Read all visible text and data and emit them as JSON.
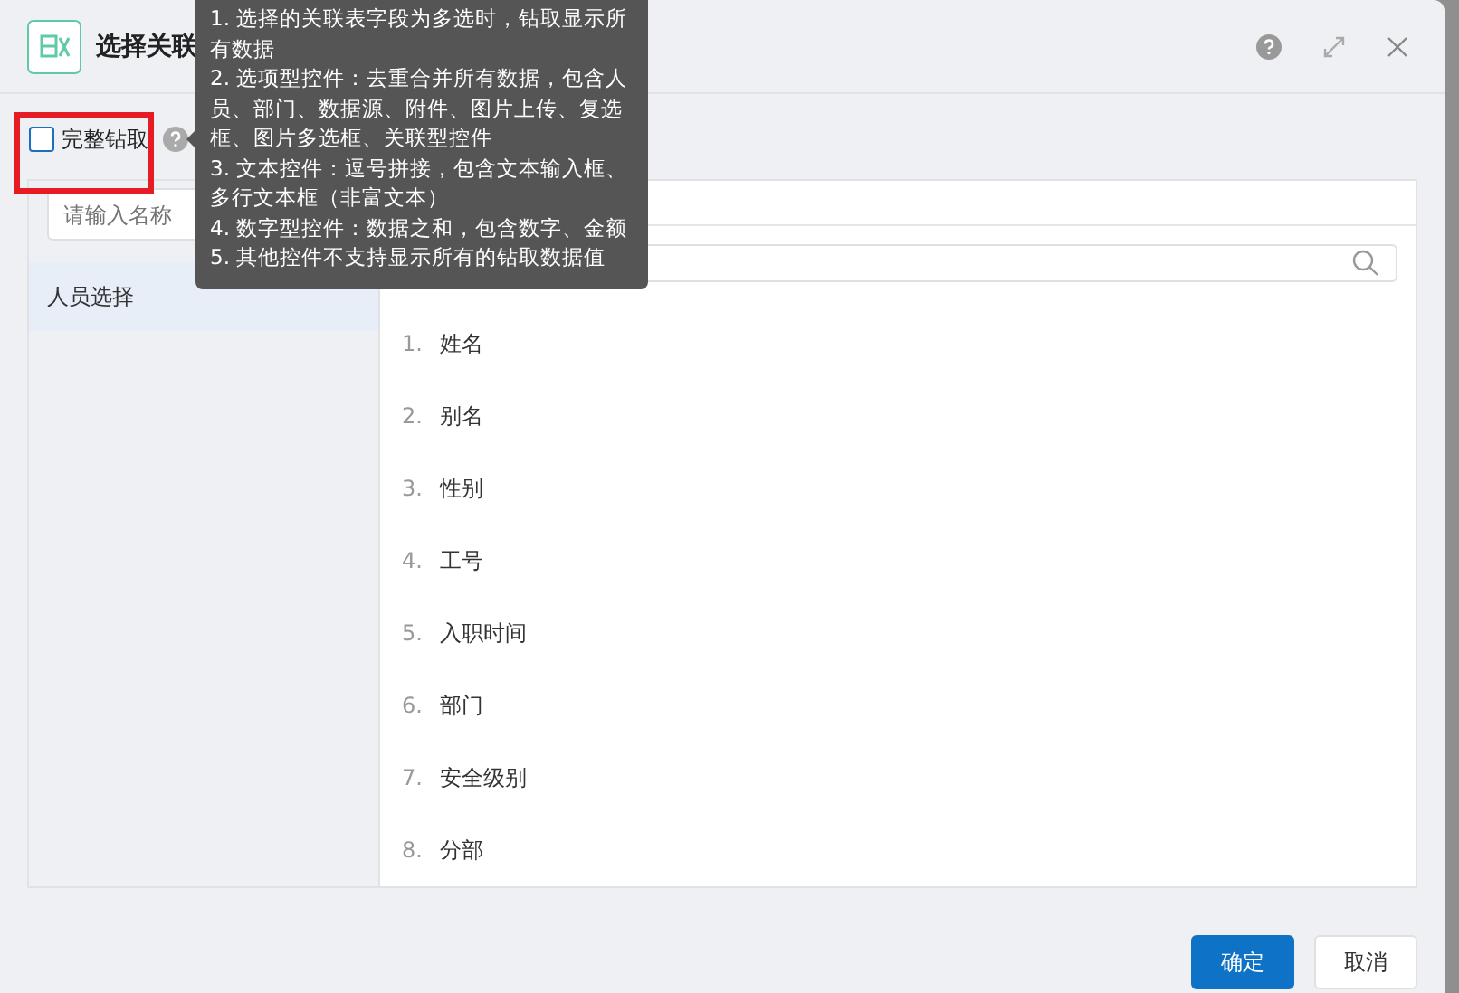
{
  "dialog": {
    "title": "选择关联"
  },
  "full_drill": {
    "label": "完整钻取",
    "checked": false,
    "highlighted": true
  },
  "tooltip": {
    "lines": [
      "1. 选择的关联表字段为多选时，钻取显示所有数据",
      "2. 选项型控件：去重合并所有数据，包含人员、部门、数据源、附件、图片上传、复选框、图片多选框、关联型控件",
      "3. 文本控件：逗号拼接，包含文本输入框、多行文本框（非富文本）",
      "4. 数字型控件：数据之和，包含数字、金额",
      "5. 其他控件不支持显示所有的钻取数据值"
    ]
  },
  "left_panel": {
    "search": {
      "placeholder": "请输入名称"
    },
    "items": [
      {
        "label": "人员选择",
        "selected": true
      }
    ]
  },
  "fields": [
    {
      "index": "1.",
      "name": "姓名"
    },
    {
      "index": "2.",
      "name": "别名"
    },
    {
      "index": "3.",
      "name": "性别"
    },
    {
      "index": "4.",
      "name": "工号"
    },
    {
      "index": "5.",
      "name": "入职时间"
    },
    {
      "index": "6.",
      "name": "部门"
    },
    {
      "index": "7.",
      "name": "安全级别"
    },
    {
      "index": "8.",
      "name": "分部"
    }
  ],
  "buttons": [
    {
      "label": "确定",
      "kind": "primary"
    },
    {
      "label": "取消",
      "kind": "default"
    }
  ]
}
